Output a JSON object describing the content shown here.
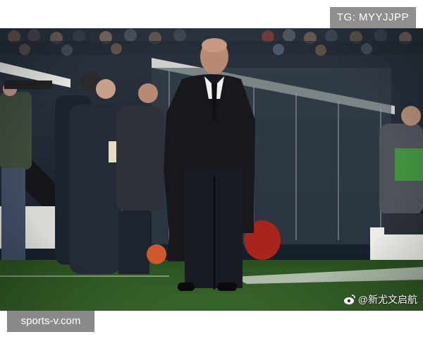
{
  "watermarks": {
    "telegram": "TG: MYYJJPP",
    "site": "sports-v.com",
    "weibo": "@新尤文启航"
  },
  "photo": {
    "subject": "bald man in long dark overcoat standing on touchline, hands in pockets",
    "setting": "football stadium at night, crowd in stands, coaching staff behind",
    "colors": {
      "pitch": "#2f5a24",
      "stands": "#1e2a33",
      "coat": "#16181d",
      "skin": "#b88a72",
      "barrier": "#d9d9d4"
    }
  }
}
